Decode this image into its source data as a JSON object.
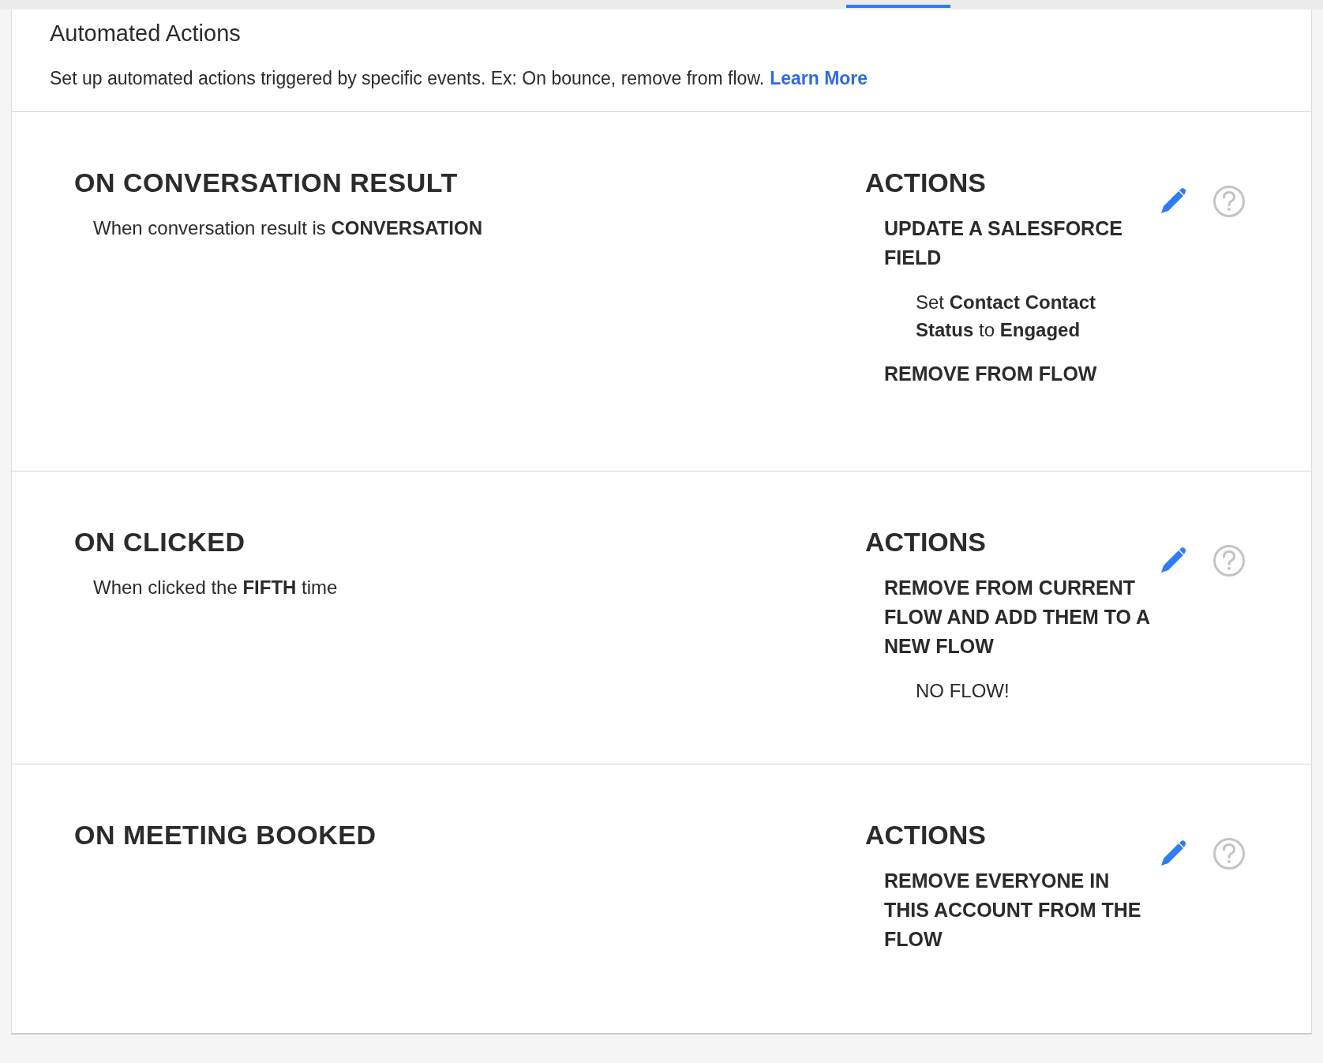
{
  "header": {
    "title": "Automated Actions",
    "description": "Set up automated actions triggered by specific events. Ex: On bounce, remove from flow.",
    "link": "Learn More"
  },
  "rules": [
    {
      "trigger": "ON CONVERSATION RESULT",
      "condition": "When conversation result is **CONVERSATION**",
      "actions_label": "ACTIONS",
      "actions": [
        {
          "name": "UPDATE A SALESFORCE FIELD",
          "detail": "Set **Contact Contact Status** to **Engaged**"
        },
        {
          "name": "REMOVE FROM FLOW"
        }
      ]
    },
    {
      "trigger": "ON CLICKED",
      "condition": "When clicked the **FIFTH** time",
      "actions_label": "ACTIONS",
      "actions": [
        {
          "name": "REMOVE FROM CURRENT FLOW AND ADD THEM TO A NEW FLOW",
          "detail": "NO FLOW!"
        }
      ]
    },
    {
      "trigger": "ON MEETING BOOKED",
      "actions_label": "ACTIONS",
      "actions": [
        {
          "name": "REMOVE EVERYONE IN THIS ACCOUNT FROM THE FLOW"
        }
      ]
    }
  ]
}
